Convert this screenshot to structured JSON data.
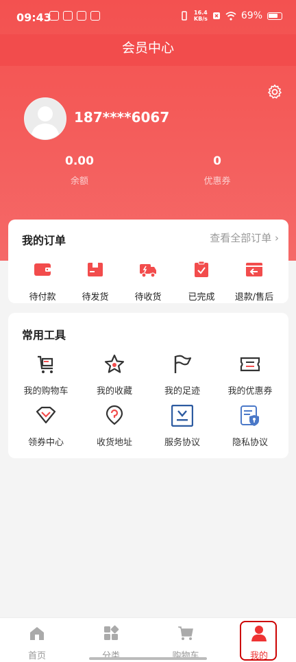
{
  "status": {
    "time": "09:43",
    "speed_top": "16.4",
    "speed_bottom": "KB/s",
    "battery": "69%"
  },
  "header": {
    "title": "会员中心"
  },
  "profile": {
    "phone": "187****6067",
    "balance_value": "0.00",
    "balance_label": "余额",
    "coupon_value": "0",
    "coupon_label": "优惠券"
  },
  "orders": {
    "title": "我的订单",
    "view_all": "查看全部订单 ›",
    "items": [
      {
        "label": "待付款",
        "icon": "wallet-icon"
      },
      {
        "label": "待发货",
        "icon": "box-icon"
      },
      {
        "label": "待收货",
        "icon": "truck-icon"
      },
      {
        "label": "已完成",
        "icon": "clipboard-check-icon"
      },
      {
        "label": "退款/售后",
        "icon": "return-icon"
      }
    ]
  },
  "tools": {
    "title": "常用工具",
    "items": [
      {
        "label": "我的购物车",
        "icon": "cart-icon"
      },
      {
        "label": "我的收藏",
        "icon": "star-icon"
      },
      {
        "label": "我的足迹",
        "icon": "flag-icon"
      },
      {
        "label": "我的优惠券",
        "icon": "ticket-icon"
      },
      {
        "label": "领券中心",
        "icon": "diamond-icon"
      },
      {
        "label": "收货地址",
        "icon": "location-icon"
      },
      {
        "label": "服务协议",
        "icon": "agreement-icon"
      },
      {
        "label": "隐私协议",
        "icon": "privacy-icon"
      }
    ]
  },
  "tabbar": {
    "items": [
      {
        "label": "首页",
        "icon": "home-icon"
      },
      {
        "label": "分类",
        "icon": "category-icon"
      },
      {
        "label": "购物车",
        "icon": "cart-icon"
      },
      {
        "label": "我的",
        "icon": "user-icon"
      }
    ],
    "active": "我的"
  },
  "colors": {
    "brand": "#f24c4c",
    "accent_text": "#e33333",
    "icon_dark": "#333333",
    "icon_blue": "#2c5aa0"
  }
}
